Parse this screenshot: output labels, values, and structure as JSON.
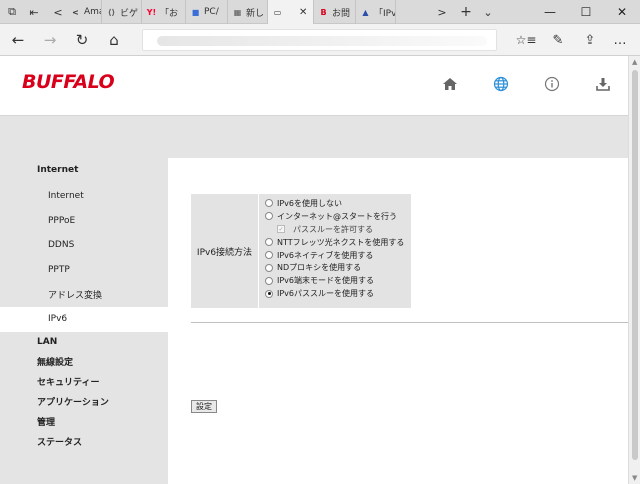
{
  "browser": {
    "tabs": [
      {
        "label": "Ama",
        "favicon": "<",
        "favicon_color": "#333333",
        "active": false
      },
      {
        "label": "ビゲ",
        "favicon": "⟨⟩",
        "favicon_color": "#555555",
        "active": false
      },
      {
        "label": "「お",
        "favicon": "Y!",
        "favicon_color": "#ff0033",
        "active": false
      },
      {
        "label": "PC/",
        "favicon": "■",
        "favicon_color": "#3a6fd8",
        "active": false
      },
      {
        "label": "新し",
        "favicon": "▦",
        "favicon_color": "#555555",
        "active": false
      },
      {
        "label": "",
        "favicon": "▭",
        "favicon_color": "#333333",
        "active": true
      },
      {
        "label": "お問",
        "favicon": "B",
        "favicon_color": "#d9001b",
        "active": false
      },
      {
        "label": "「IPv",
        "favicon": "▲",
        "favicon_color": "#2b4fa8",
        "active": false
      }
    ],
    "close_tab": "✕",
    "new_tab": "+",
    "tab_list": "⌄",
    "scroll_tabs_left": "<",
    "scroll_tabs_right": ">",
    "window_controls": {
      "minimize": "—",
      "maximize": "☐",
      "close": "✕"
    },
    "nav": {
      "back": "←",
      "forward": "→",
      "refresh": "↻",
      "home": "⌂"
    },
    "toolbar_icons": {
      "favorites": "☆≡",
      "notes": "✎",
      "share": "⇪",
      "more": "…"
    }
  },
  "router": {
    "brand": "BUFFALO",
    "brand_color": "#d9001b",
    "header_icons": [
      "home-icon",
      "globe-icon",
      "info-icon",
      "download-icon"
    ],
    "sidebar": {
      "section_internet": "Internet",
      "internet_items": [
        {
          "label": "Internet",
          "active": false
        },
        {
          "label": "PPPoE",
          "active": false
        },
        {
          "label": "DDNS",
          "active": false
        },
        {
          "label": "PPTP",
          "active": false
        },
        {
          "label": "アドレス変換",
          "active": false
        },
        {
          "label": "IPv6",
          "active": true
        }
      ],
      "sections": [
        "LAN",
        "無線設定",
        "セキュリティー",
        "アプリケーション",
        "管理",
        "ステータス"
      ]
    },
    "form": {
      "label": "IPv6接続方法",
      "options": [
        {
          "label": "IPv6を使用しない",
          "type": "radio",
          "checked": false
        },
        {
          "label": "インターネット@スタートを行う",
          "type": "radio",
          "checked": false
        },
        {
          "label": "パススルーを許可する",
          "type": "checkbox",
          "checked": true
        },
        {
          "label": "NTTフレッツ光ネクストを使用する",
          "type": "radio",
          "checked": false
        },
        {
          "label": "IPv6ネイティブを使用する",
          "type": "radio",
          "checked": false
        },
        {
          "label": "NDプロキシを使用する",
          "type": "radio",
          "checked": false
        },
        {
          "label": "IPv6端末モードを使用する",
          "type": "radio",
          "checked": false
        },
        {
          "label": "IPv6パススルーを使用する",
          "type": "radio",
          "checked": true
        }
      ],
      "submit_label": "設定"
    }
  }
}
